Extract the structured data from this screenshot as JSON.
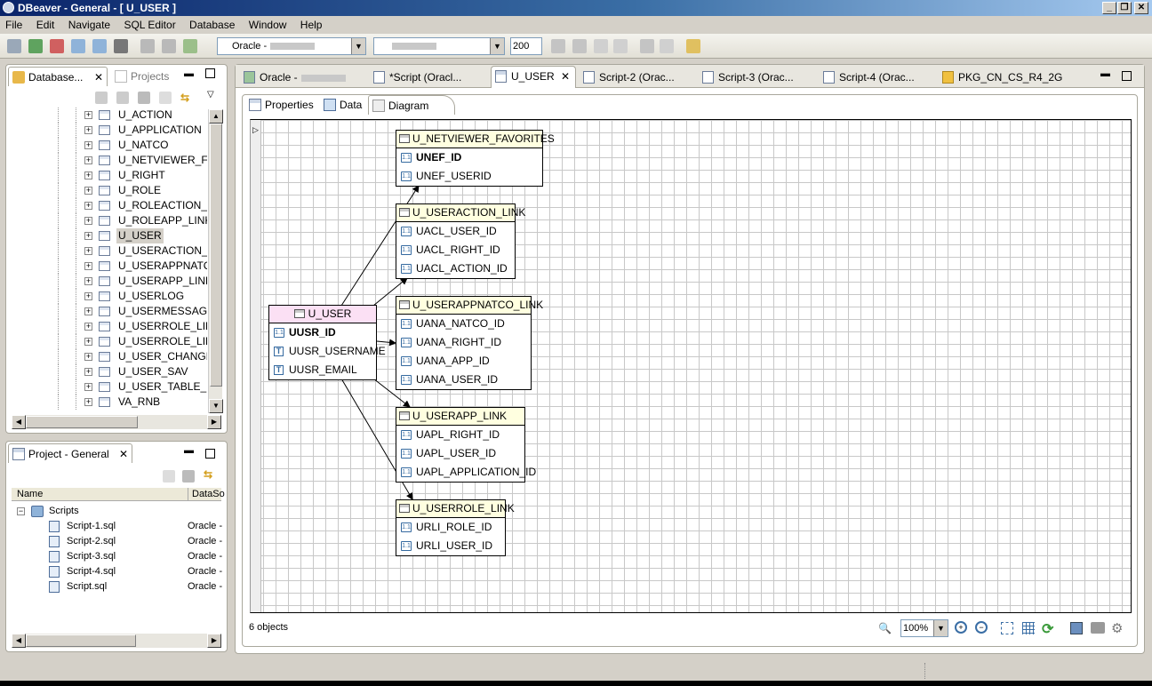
{
  "window": {
    "title": "DBeaver - General - [ U_USER ]"
  },
  "menu": [
    "File",
    "Edit",
    "Navigate",
    "SQL Editor",
    "Database",
    "Window",
    "Help"
  ],
  "toolbar": {
    "connection": "Oracle -",
    "schema": "",
    "limit": "200"
  },
  "navigator": {
    "tab_label": "Database...",
    "projects_tab_label": "Projects",
    "items": [
      "U_ACTION",
      "U_APPLICATION",
      "U_NATCO",
      "U_NETVIEWER_FAV",
      "U_RIGHT",
      "U_ROLE",
      "U_ROLEACTION_LIN",
      "U_ROLEAPP_LINK",
      "U_USER",
      "U_USERACTION_LIN",
      "U_USERAPPNATCO",
      "U_USERAPP_LINK",
      "U_USERLOG",
      "U_USERMESSAGIN",
      "U_USERROLE_LINK",
      "U_USERROLE_LINK",
      "U_USER_CHANGES",
      "U_USER_SAV",
      "U_USER_TABLE_FIL",
      "VA_RNB"
    ],
    "selected": "U_USER"
  },
  "project": {
    "tab_label": "Project - General",
    "col_name": "Name",
    "col_datasource": "DataSo",
    "root": "Scripts",
    "scripts": [
      {
        "name": "Script-1.sql",
        "ds": "Oracle -"
      },
      {
        "name": "Script-2.sql",
        "ds": "Oracle -"
      },
      {
        "name": "Script-3.sql",
        "ds": "Oracle -"
      },
      {
        "name": "Script-4.sql",
        "ds": "Oracle -"
      },
      {
        "name": "Script.sql",
        "ds": "Oracle -"
      }
    ]
  },
  "editor_tabs": [
    "Oracle -",
    "*Script (Oracl...",
    "U_USER",
    "Script-2 (Orac...",
    "Script-3 (Orac...",
    "Script-4 (Orac...",
    "PKG_CN_CS_R4_2G"
  ],
  "sub_tabs": [
    "Properties",
    "Data",
    "Diagram"
  ],
  "diagram": {
    "main": {
      "name": "U_USER",
      "cols": [
        {
          "n": "UUSR_ID",
          "pk": true
        },
        {
          "n": "UUSR_USERNAME",
          "pk": false
        },
        {
          "n": "UUSR_EMAIL",
          "pk": false
        }
      ]
    },
    "tables": [
      {
        "name": "U_NETVIEWER_FAVORITES",
        "cols": [
          "UNEF_ID",
          "UNEF_USERID"
        ],
        "bold": "UNEF_ID"
      },
      {
        "name": "U_USERACTION_LINK",
        "cols": [
          "UACL_USER_ID",
          "UACL_RIGHT_ID",
          "UACL_ACTION_ID"
        ]
      },
      {
        "name": "U_USERAPPNATCO_LINK",
        "cols": [
          "UANA_NATCO_ID",
          "UANA_RIGHT_ID",
          "UANA_APP_ID",
          "UANA_USER_ID"
        ]
      },
      {
        "name": "U_USERAPP_LINK",
        "cols": [
          "UAPL_RIGHT_ID",
          "UAPL_USER_ID",
          "UAPL_APPLICATION_ID"
        ]
      },
      {
        "name": "U_USERROLE_LINK",
        "cols": [
          "URLI_ROLE_ID",
          "URLI_USER_ID"
        ]
      }
    ]
  },
  "status": {
    "objects": "6 objects",
    "zoom": "100%"
  }
}
